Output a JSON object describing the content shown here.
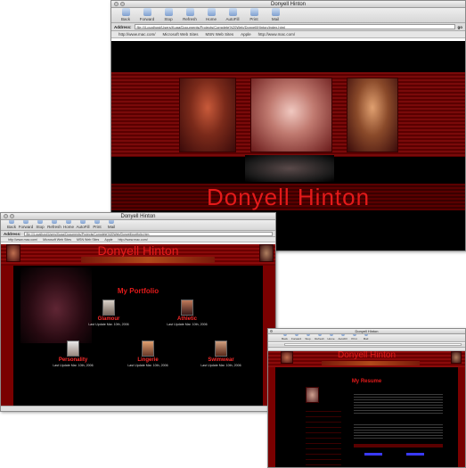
{
  "browser": {
    "nav_buttons": [
      "Back",
      "Forward",
      "Stop",
      "Refresh",
      "Home",
      "AutoFill",
      "Print",
      "Mail"
    ],
    "address_label": "Address:",
    "go_label": "go",
    "favorites": [
      "http://www.mac.com/",
      "Microsoft Web Sites",
      "MSN Web Sites",
      "Apple",
      "http://www.mac.com/"
    ]
  },
  "win_home": {
    "title": "Donyell Hinton",
    "url": "file:///Localhost/Users/Kuga/Documents/Projects/Complete%20Web/Donyell/Hinton/index.html",
    "banner_name": "Donyell Hinton"
  },
  "win_portfolio": {
    "title": "Donyell Hinton",
    "url": "file:///Localhost/Users/Kuga/Documents/Projects/Complete%20Web/Donyell/portfolio.htm",
    "banner_name": "Donyell Hinton",
    "heading": "My Portfolio",
    "items": [
      {
        "label": "Glamour",
        "date": "Last Update Mar. 10th, 2006"
      },
      {
        "label": "Athletic",
        "date": "Last Update Mar. 10th, 2006"
      },
      {
        "label": "Personality",
        "date": "Last Update Mar. 10th, 2006"
      },
      {
        "label": "Lingerie",
        "date": "Last Update Mar. 10th, 2006"
      },
      {
        "label": "Swimwear",
        "date": "Last Update Mar. 10th, 2006"
      }
    ]
  },
  "win_resume": {
    "title": "Donyell Hinton",
    "banner_name": "Donyell Hinton",
    "heading": "My Resume"
  },
  "colors": {
    "accent_red": "#e31a1a",
    "banner_dark": "#5a0000",
    "page_black": "#000000"
  }
}
